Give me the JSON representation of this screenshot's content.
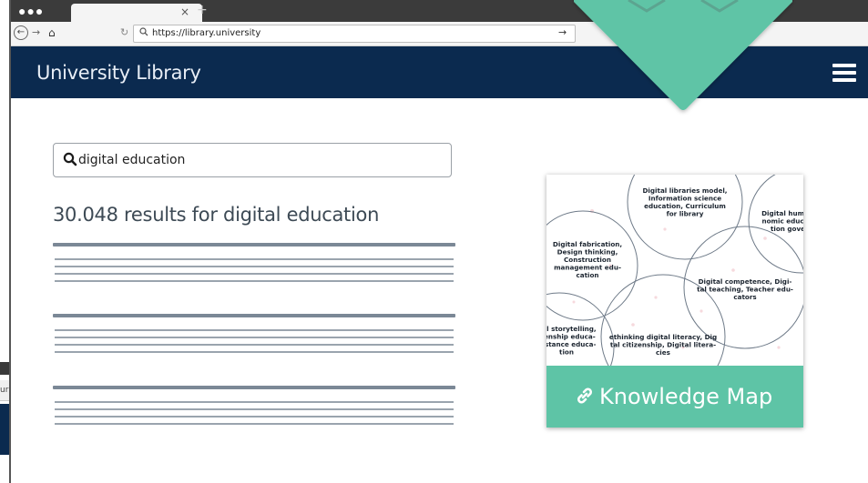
{
  "browser": {
    "tab_close": "×",
    "new_tab": "+",
    "url": "https://library.university",
    "window_dots": "●●●"
  },
  "back_window": {
    "url_fragment": "ur"
  },
  "header": {
    "title": "University Library"
  },
  "search": {
    "value": "digital education"
  },
  "results": {
    "count_text": "30.048 results for digital education"
  },
  "knowledge_map": {
    "button_label": "Knowledge Map",
    "bubbles": [
      {
        "lines": [
          "Digital libraries model,",
          "Information science",
          "education, Curriculum",
          "for library"
        ]
      },
      {
        "lines": [
          "Digital huma",
          "nomic educa",
          "tion gove"
        ]
      },
      {
        "lines": [
          "Digital fabrication,",
          "Design thinking,",
          "Construction",
          "management edu-",
          "cation"
        ]
      },
      {
        "lines": [
          "Digital competence, Digi-",
          "tal teaching, Teacher edu-",
          "cators"
        ]
      },
      {
        "lines": [
          "ital storytelling,",
          "izenship educa-",
          "Distance educa-",
          "tion"
        ]
      },
      {
        "lines": [
          "ethinking digital literacy, Dig",
          "tal citizenship, Digital litera-",
          "cies"
        ]
      }
    ]
  },
  "colors": {
    "header_bg": "#0b2a4f",
    "accent_green": "#5ec4a6",
    "result_bar": "#7b8896"
  }
}
